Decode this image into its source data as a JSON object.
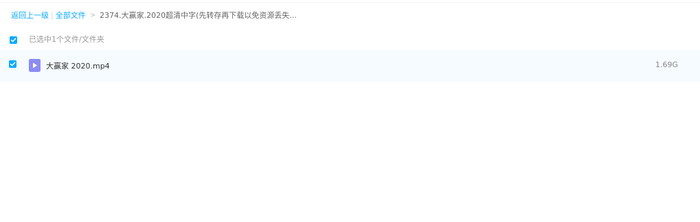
{
  "breadcrumb": {
    "back_label": "返回上一级",
    "separator": "|",
    "root_label": "全部文件",
    "arrow": ">",
    "current_folder": "2374.大赢家.2020超清中字(先转存再下载以免资源丢失..."
  },
  "selection": {
    "checked": true,
    "summary": "已选中1个文件/文件夹"
  },
  "files": [
    {
      "checked": true,
      "icon": "video-file-icon",
      "name": "大赢家 2020.mp4",
      "size": "1.69G"
    }
  ],
  "colors": {
    "accent": "#09AAFF",
    "row_highlight": "#f5fbff",
    "video_icon": "#8c8cf5"
  }
}
